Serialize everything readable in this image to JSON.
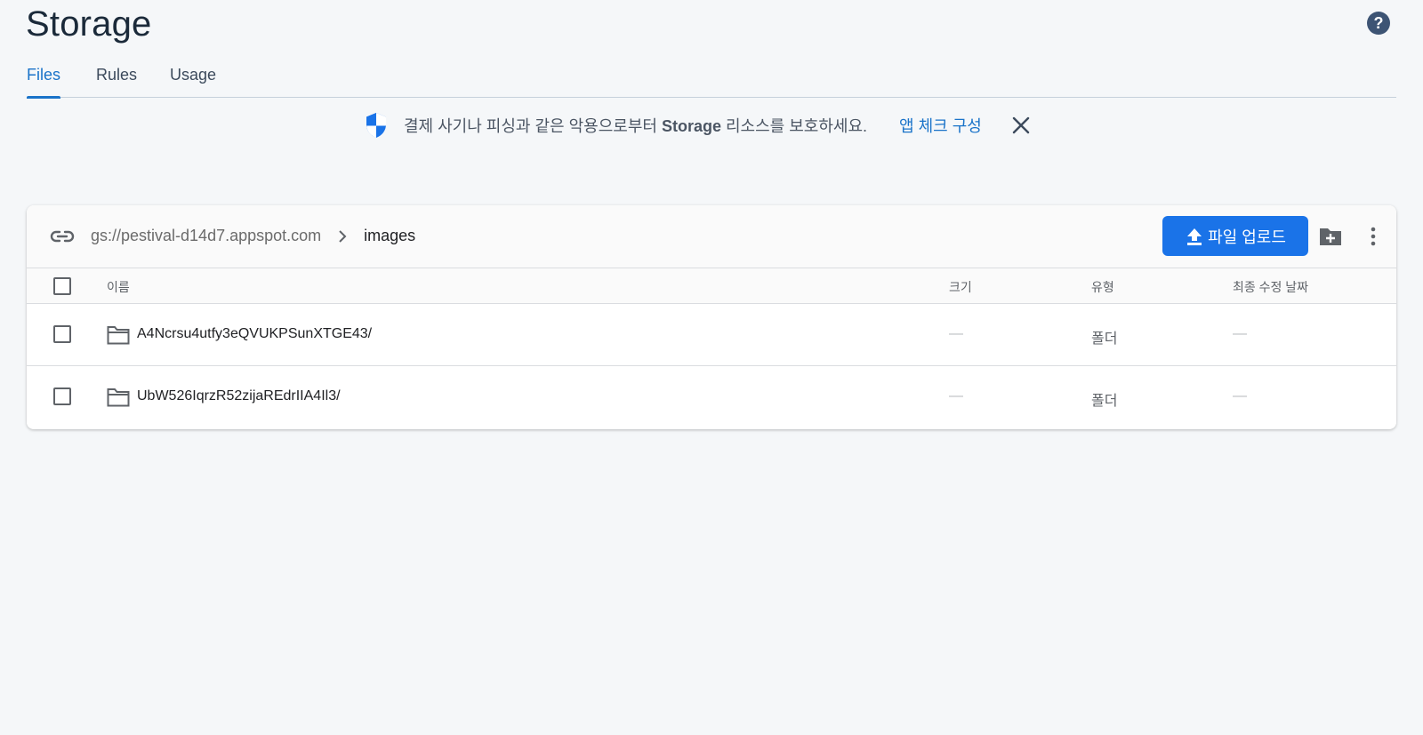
{
  "header": {
    "title": "Storage",
    "help_icon": "help-circle-icon"
  },
  "tabs": [
    {
      "label": "Files",
      "active": true
    },
    {
      "label": "Rules",
      "active": false
    },
    {
      "label": "Usage",
      "active": false
    }
  ],
  "notice": {
    "icon": "shield-icon",
    "text_before": "결제 사기나 피싱과 같은 악용으로부터 ",
    "text_bold": "Storage",
    "text_after": " 리소스를 보호하세요.",
    "link_label": "앱 체크 구성",
    "close_icon": "close-icon"
  },
  "browser": {
    "breadcrumb": {
      "bucket": "gs://pestival-d14d7.appspot.com",
      "current": "images"
    },
    "upload_label": "파일 업로드",
    "columns": {
      "name": "이름",
      "size": "크기",
      "type": "유형",
      "modified": "최종 수정 날짜"
    },
    "rows": [
      {
        "name": "A4Ncrsu4utfy3eQVUKPSunXTGE43/",
        "size": "—",
        "type": "폴더",
        "modified": "—"
      },
      {
        "name": "UbW526IqrzR52zijaREdrIIA4Il3/",
        "size": "—",
        "type": "폴더",
        "modified": "—"
      }
    ]
  },
  "colors": {
    "accent": "#1a73e8",
    "tab_active": "#1a73c9",
    "background": "#f5f7f9"
  }
}
